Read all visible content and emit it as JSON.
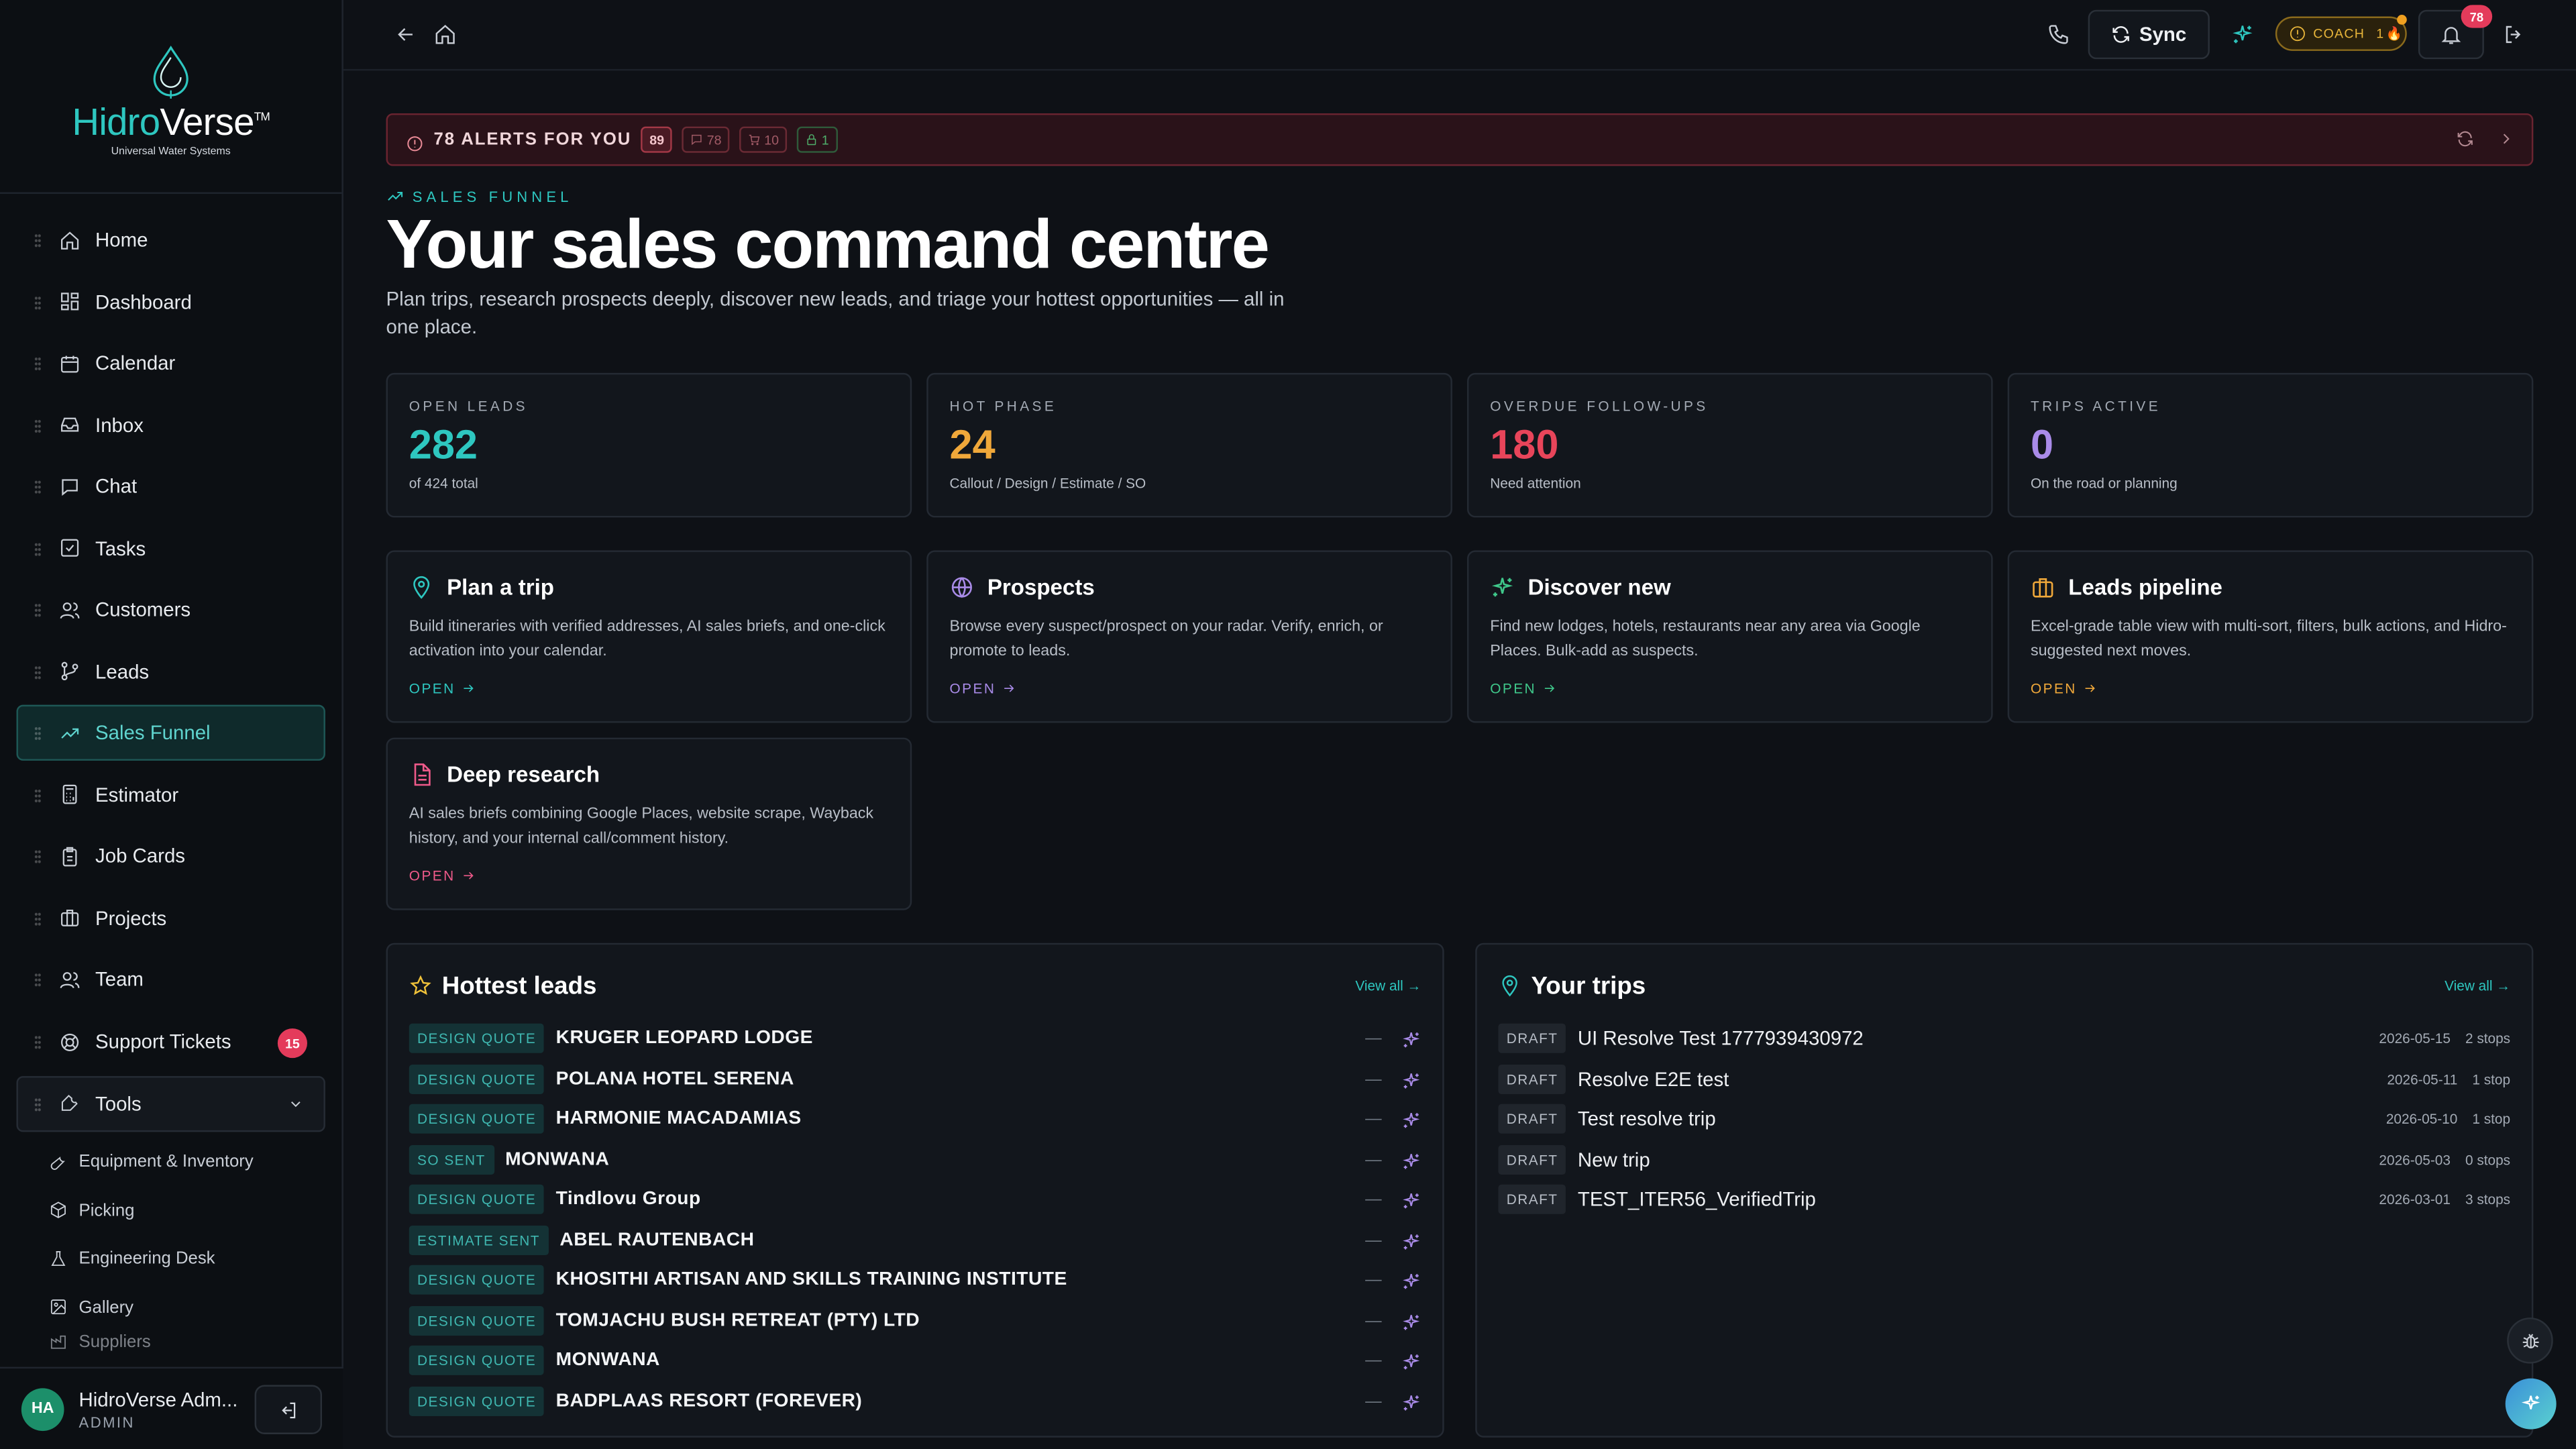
{
  "brand": {
    "name_a": "Hidro",
    "name_b": "Verse",
    "tm": "TM",
    "tagline": "Universal Water Systems"
  },
  "sidebar": {
    "items": [
      {
        "label": "Home",
        "icon": "home-icon"
      },
      {
        "label": "Dashboard",
        "icon": "dashboard-icon"
      },
      {
        "label": "Calendar",
        "icon": "calendar-icon"
      },
      {
        "label": "Inbox",
        "icon": "inbox-icon"
      },
      {
        "label": "Chat",
        "icon": "chat-icon"
      },
      {
        "label": "Tasks",
        "icon": "tasks-icon"
      },
      {
        "label": "Customers",
        "icon": "customers-icon"
      },
      {
        "label": "Leads",
        "icon": "leads-icon"
      },
      {
        "label": "Sales Funnel",
        "icon": "trending-up-icon",
        "active": true
      },
      {
        "label": "Estimator",
        "icon": "calculator-icon"
      },
      {
        "label": "Job Cards",
        "icon": "clipboard-icon"
      },
      {
        "label": "Projects",
        "icon": "briefcase-icon"
      },
      {
        "label": "Team",
        "icon": "team-icon"
      }
    ],
    "support": {
      "label": "Support Tickets",
      "count": "15"
    },
    "tools": {
      "label": "Tools"
    },
    "sub_items": [
      {
        "label": "Equipment & Inventory",
        "icon": "wrench-icon"
      },
      {
        "label": "Picking",
        "icon": "package-icon"
      },
      {
        "label": "Engineering Desk",
        "icon": "flask-icon"
      },
      {
        "label": "Gallery",
        "icon": "image-icon"
      },
      {
        "label": "Suppliers",
        "icon": "factory-icon"
      }
    ],
    "user": {
      "initials": "HA",
      "name": "HidroVerse Adm...",
      "role": "ADMIN"
    }
  },
  "topbar": {
    "sync_label": "Sync",
    "coach_label": "COACH",
    "coach_count": "1",
    "notif_count": "78"
  },
  "alerts": {
    "title": "78 ALERTS FOR YOU",
    "total": "89",
    "c1": "78",
    "c2": "10",
    "c3": "1"
  },
  "page": {
    "kicker": "SALES FUNNEL",
    "title": "Your sales command centre",
    "intro": "Plan trips, research prospects deeply, discover new leads, and triage your hottest opportunities — all in one place."
  },
  "stats": [
    {
      "label": "OPEN LEADS",
      "value": "282",
      "sub": "of 424 total",
      "color": "#2ec7c0"
    },
    {
      "label": "HOT PHASE",
      "value": "24",
      "sub": "Callout / Design / Estimate / SO",
      "color": "#f0a83a"
    },
    {
      "label": "OVERDUE FOLLOW-UPS",
      "value": "180",
      "sub": "Need attention",
      "color": "#e8455a"
    },
    {
      "label": "TRIPS ACTIVE",
      "value": "0",
      "sub": "On the road or planning",
      "color": "#a98be8"
    }
  ],
  "cards": [
    {
      "title": "Plan a trip",
      "desc": "Build itineraries with verified addresses, AI sales briefs, and one-click activation into your calendar.",
      "open": "OPEN",
      "color": "#2ec7c0",
      "icon": "map-pin-icon"
    },
    {
      "title": "Prospects",
      "desc": "Browse every suspect/prospect on your radar. Verify, enrich, or promote to leads.",
      "open": "OPEN",
      "color": "#a98be8",
      "icon": "globe-icon"
    },
    {
      "title": "Discover new",
      "desc": "Find new lodges, hotels, restaurants near any area via Google Places. Bulk-add as suspects.",
      "open": "OPEN",
      "color": "#3fc78a",
      "icon": "sparkles-icon"
    },
    {
      "title": "Leads pipeline",
      "desc": "Excel-grade table view with multi-sort, filters, bulk actions, and Hidro-suggested next moves.",
      "open": "OPEN",
      "color": "#f0a83a",
      "icon": "briefcase-icon"
    },
    {
      "title": "Deep research",
      "desc": "AI sales briefs combining Google Places, website scrape, Wayback history, and your internal call/comment history.",
      "open": "OPEN",
      "color": "#ef5a8a",
      "icon": "document-icon"
    }
  ],
  "hottest": {
    "title": "Hottest leads",
    "view_all": "View all →",
    "rows": [
      {
        "tag": "DESIGN QUOTE",
        "name": "KRUGER LEOPARD LODGE",
        "dash": "—"
      },
      {
        "tag": "DESIGN QUOTE",
        "name": "POLANA HOTEL SERENA",
        "dash": "—"
      },
      {
        "tag": "DESIGN QUOTE",
        "name": "HARMONIE MACADAMIAS",
        "dash": "—"
      },
      {
        "tag": "SO SENT",
        "name": "MONWANA",
        "dash": "—"
      },
      {
        "tag": "DESIGN QUOTE",
        "name": "Tindlovu Group",
        "dash": "—"
      },
      {
        "tag": "ESTIMATE SENT",
        "name": "ABEL RAUTENBACH",
        "dash": "—"
      },
      {
        "tag": "DESIGN QUOTE",
        "name": "KHOSITHI ARTISAN AND SKILLS TRAINING INSTITUTE",
        "dash": "—"
      },
      {
        "tag": "DESIGN QUOTE",
        "name": "TOMJACHU BUSH RETREAT (PTY) LTD",
        "dash": "—"
      },
      {
        "tag": "DESIGN QUOTE",
        "name": "MONWANA",
        "dash": "—"
      },
      {
        "tag": "DESIGN QUOTE",
        "name": "BADPLAAS RESORT (FOREVER)",
        "dash": "—"
      }
    ]
  },
  "trips": {
    "title": "Your trips",
    "view_all": "View all →",
    "rows": [
      {
        "status": "DRAFT",
        "name": "UI Resolve Test 1777939430972",
        "date": "2026-05-15",
        "stops": "2 stops"
      },
      {
        "status": "DRAFT",
        "name": "Resolve E2E test",
        "date": "2026-05-11",
        "stops": "1 stop"
      },
      {
        "status": "DRAFT",
        "name": "Test resolve trip",
        "date": "2026-05-10",
        "stops": "1 stop"
      },
      {
        "status": "DRAFT",
        "name": "New trip",
        "date": "2026-05-03",
        "stops": "0 stops"
      },
      {
        "status": "DRAFT",
        "name": "TEST_ITER56_VerifiedTrip",
        "date": "2026-03-01",
        "stops": "3 stops"
      }
    ]
  }
}
